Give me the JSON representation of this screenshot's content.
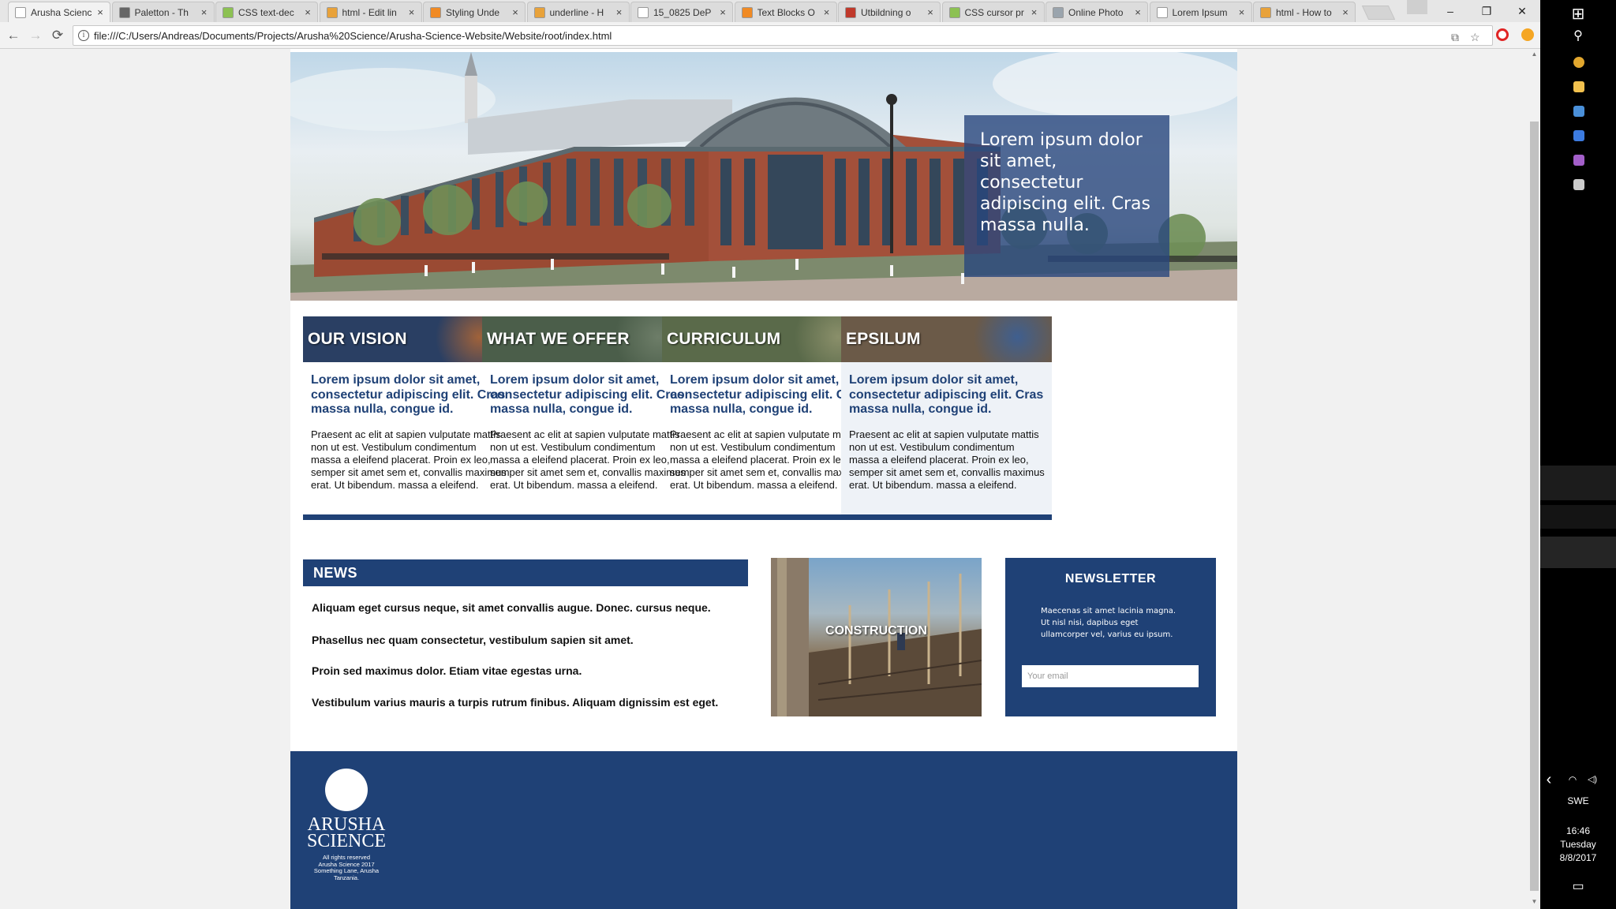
{
  "browser": {
    "tabs": [
      {
        "title": "Arusha Scienc",
        "fav": "#ffffff",
        "active": true
      },
      {
        "title": "Paletton - Th",
        "fav": "#666666"
      },
      {
        "title": "CSS text-dec",
        "fav": "#8cc152"
      },
      {
        "title": "html - Edit lin",
        "fav": "#e8a23a"
      },
      {
        "title": "Styling Unde",
        "fav": "#f08a24"
      },
      {
        "title": "underline - H",
        "fav": "#e8a23a"
      },
      {
        "title": "15_0825 DeP",
        "fav": "#ffffff"
      },
      {
        "title": "Text Blocks O",
        "fav": "#f08a24"
      },
      {
        "title": "Utbildning o",
        "fav": "#c0392b"
      },
      {
        "title": "CSS cursor pr",
        "fav": "#8cc152"
      },
      {
        "title": "Online Photo",
        "fav": "#9aa4ad"
      },
      {
        "title": "Lorem Ipsum",
        "fav": "#ffffff"
      },
      {
        "title": "html - How to",
        "fav": "#e8a23a"
      }
    ],
    "tab_close_glyph": "×",
    "window_controls": {
      "minimize": "–",
      "restore": "❐",
      "close": "✕"
    },
    "nav": {
      "back": "←",
      "forward": "→",
      "reload": "⟳"
    },
    "info_glyph": "i",
    "url": "file:///C:/Users/Andreas/Documents/Projects/Arusha%20Science/Arusha-Science-Website/Website/root/index.html",
    "omnibox_icons": {
      "translate": "⧉",
      "star": "☆"
    },
    "extension_colors": [
      "#e02424",
      "#f5a623"
    ]
  },
  "hero": {
    "caption": "Lorem ipsum dolor sit amet, consectetur adipiscing elit. Cras massa nulla."
  },
  "cards": [
    {
      "title": "OUR VISION",
      "banner_color": "#2a3f63",
      "photo_color": "#a0623a",
      "heading": "Lorem ipsum dolor sit amet, consectetur adipiscing elit. Cras massa nulla, congue id.",
      "text": "Praesent ac elit at sapien vulputate mattis non ut est. Vestibulum condimentum massa a eleifend placerat. Proin ex leo, semper sit amet sem et, convallis maximus erat. Ut bibendum. massa a eleifend."
    },
    {
      "title": "WHAT WE OFFER",
      "banner_color": "#4b5e4a",
      "photo_color": "#6d7d68",
      "heading": "Lorem ipsum dolor sit amet, consectetur adipiscing elit. Cras massa nulla, congue id.",
      "text": "Praesent ac elit at sapien vulputate mattis non ut est. Vestibulum condimentum massa a eleifend placerat. Proin ex leo, semper sit amet sem et, convallis maximus erat. Ut bibendum. massa a eleifend."
    },
    {
      "title": "CURRICULUM",
      "banner_color": "#5a6a4a",
      "photo_color": "#8a8f6a",
      "heading": "Lorem ipsum dolor sit amet, consectetur adipiscing elit. Cras massa nulla, congue id.",
      "text": "Praesent ac elit at sapien vulputate mattis non ut est. Vestibulum condimentum massa a eleifend placerat. Proin ex leo, semper sit amet sem et, convallis maximus erat. Ut bibendum. massa a eleifend."
    },
    {
      "title": "EPSILUM",
      "banner_color": "#6b5a48",
      "photo_color": "#3f5f8f",
      "heading": "Lorem ipsum dolor sit amet, consectetur adipiscing elit. Cras massa nulla, congue id.",
      "text": "Praesent ac elit at sapien vulputate mattis non ut est. Vestibulum condimentum massa a eleifend placerat. Proin ex leo, semper sit amet sem et, convallis maximus erat. Ut bibendum. massa a eleifend."
    }
  ],
  "news": {
    "title": "NEWS",
    "items": [
      "Aliquam eget cursus neque, sit amet convallis augue. Donec. cursus neque.",
      "Phasellus nec quam consectetur, vestibulum sapien sit amet.",
      "Proin sed maximus dolor. Etiam vitae egestas urna.",
      "Vestibulum varius mauris a turpis rutrum finibus. Aliquam dignissim est eget."
    ]
  },
  "construction": {
    "label": "CONSTRUCTION"
  },
  "newsletter": {
    "title": "NEWSLETTER",
    "text": "Maecenas sit amet lacinia magna. Ut nisl nisi, dapibus eget ullamcorper vel, varius eu ipsum.",
    "email_placeholder": "Your email"
  },
  "footer": {
    "logo_line1": "ARUSHA",
    "logo_line2": "SCIENCE",
    "small_lines": [
      "All rights reserved",
      "Arusha Science 2017",
      "Something Lane, Arusha",
      "Tanzania."
    ]
  },
  "taskbar": {
    "icons": {
      "start": "⊞",
      "search": "⚲",
      "chevron": "‹",
      "wifi": "◠",
      "volume": "◁)",
      "notifications": "▭"
    },
    "apps": [
      "#e2a72e",
      "#f2c14e",
      "#4a90d9",
      "#3c7be0",
      "#a35fc9",
      "#cccccc"
    ],
    "language": "SWE",
    "time": "16:46",
    "day": "Tuesday",
    "date": "8/8/2017"
  },
  "colors": {
    "primary": "#1f4176",
    "heading": "#1f4176",
    "page_bg": "#f1f1f1"
  }
}
